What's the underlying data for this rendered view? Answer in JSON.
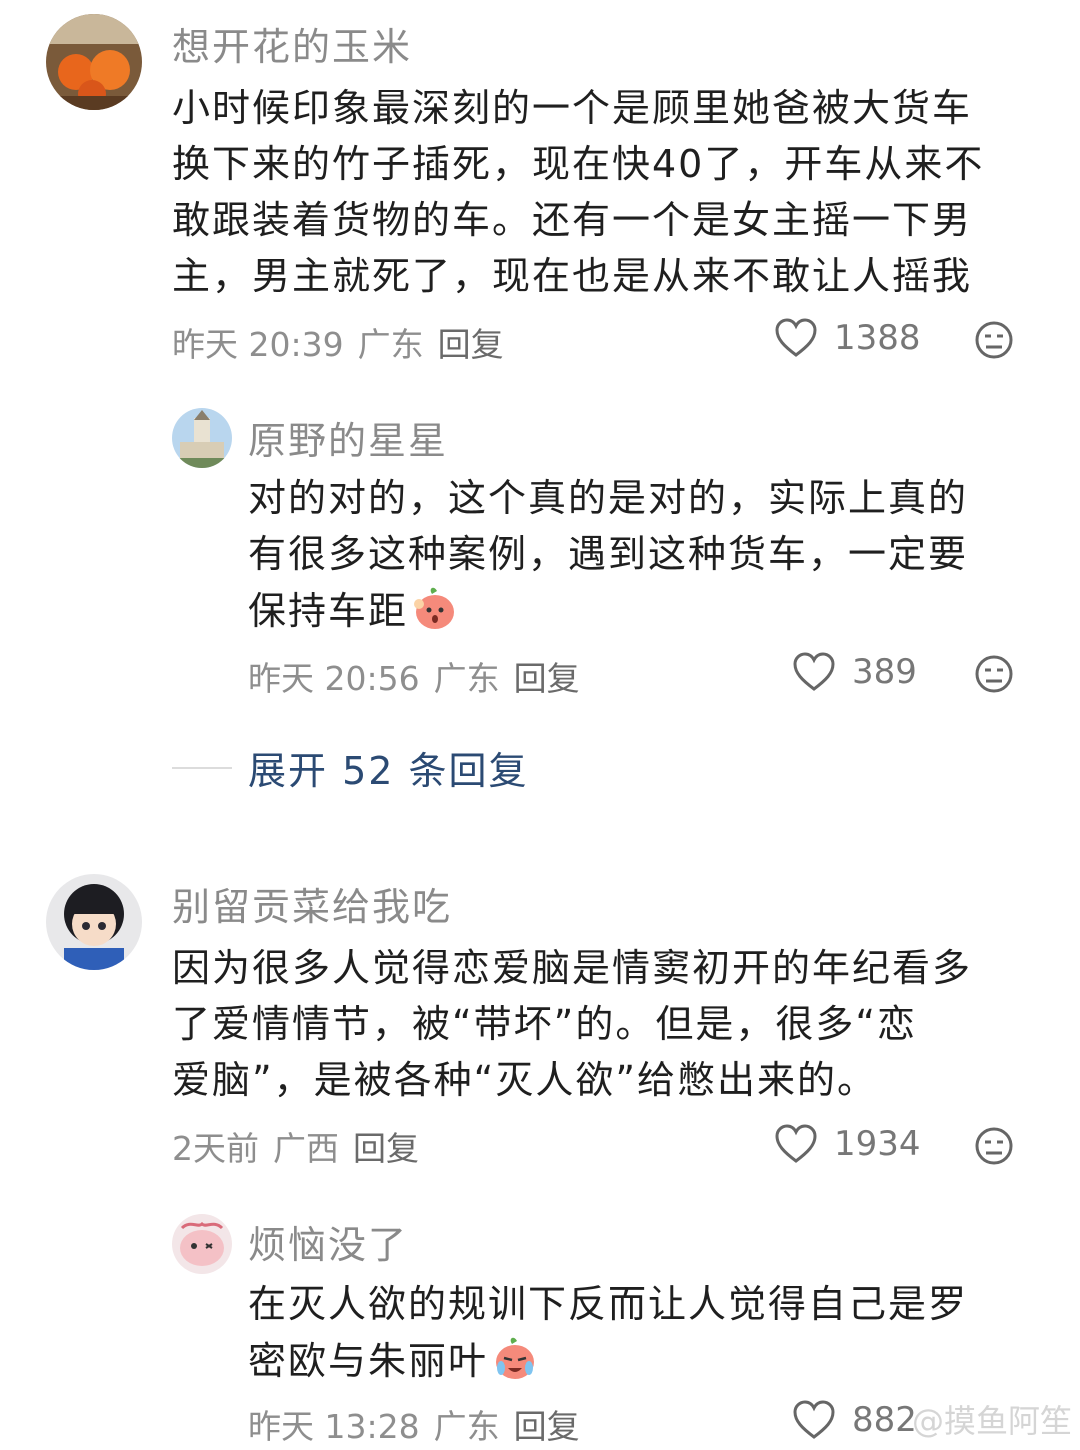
{
  "comments": [
    {
      "username": "想开花的玉米",
      "lines": [
        "小时候印象最深刻的一个是顾里她爸被大货车",
        "换下来的竹子插死，现在快40了，开车从来不",
        "敢跟装着货物的车。还有一个是女主摇一下男",
        "主，男主就死了，现在也是从来不敢让人摇我"
      ],
      "time": "昨天 20:39",
      "location": "广东",
      "reply_label": "回复",
      "likes": "1388"
    },
    {
      "username": "原野的星星",
      "lines": [
        "对的对的，这个真的是对的，实际上真的",
        "有很多这种案例，遇到这种货车，一定要",
        "保持车距"
      ],
      "time": "昨天 20:56",
      "location": "广东",
      "reply_label": "回复",
      "likes": "389"
    },
    {
      "username": "别留贡菜给我吃",
      "lines": [
        "因为很多人觉得恋爱脑是情窦初开的年纪看多",
        "了爱情情节，被“带坏”的。但是，很多“恋",
        "爱脑”，是被各种“灭人欲”给憋出来的。"
      ],
      "time": "2天前",
      "location": "广西",
      "reply_label": "回复",
      "likes": "1934"
    },
    {
      "username": "烦恼没了",
      "lines": [
        "在灭人欲的规训下反而让人觉得自己是罗",
        "密欧与朱丽叶"
      ],
      "time": "昨天 13:28",
      "location": "广东",
      "reply_label": "回复",
      "likes": "882"
    }
  ],
  "expand_label": "展开 52 条回复",
  "watermark": "@摸鱼阿笙",
  "colors": {
    "link": "#2b4a73",
    "meta": "#8e8e8e",
    "name": "#8a8a8a"
  }
}
